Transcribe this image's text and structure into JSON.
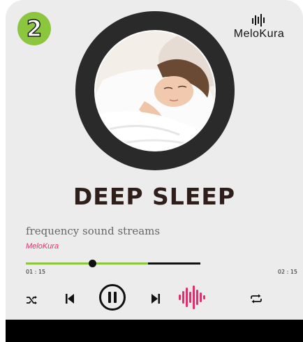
{
  "badge": {
    "label": "2"
  },
  "brand": {
    "name": "MeloKura",
    "icon": "waveform-icon"
  },
  "track": {
    "title": "DEEP SLEEP",
    "subtitle": "frequency sound streams",
    "artist": "MeloKura",
    "elapsed": "01 : 15",
    "duration": "02 : 15",
    "progress_fraction": 0.38,
    "buffered_fraction": 0.7
  },
  "controls": {
    "shuffle": "shuffle-icon",
    "previous": "skip-previous-icon",
    "play_pause": "pause-icon",
    "next": "skip-next-icon",
    "visualizer": "sound-waveform-icon",
    "repeat": "repeat-icon"
  },
  "colors": {
    "accent_green": "#8cc63f",
    "accent_pink": "#e0306e",
    "title": "#2f1f1a",
    "background": "#ececec"
  }
}
